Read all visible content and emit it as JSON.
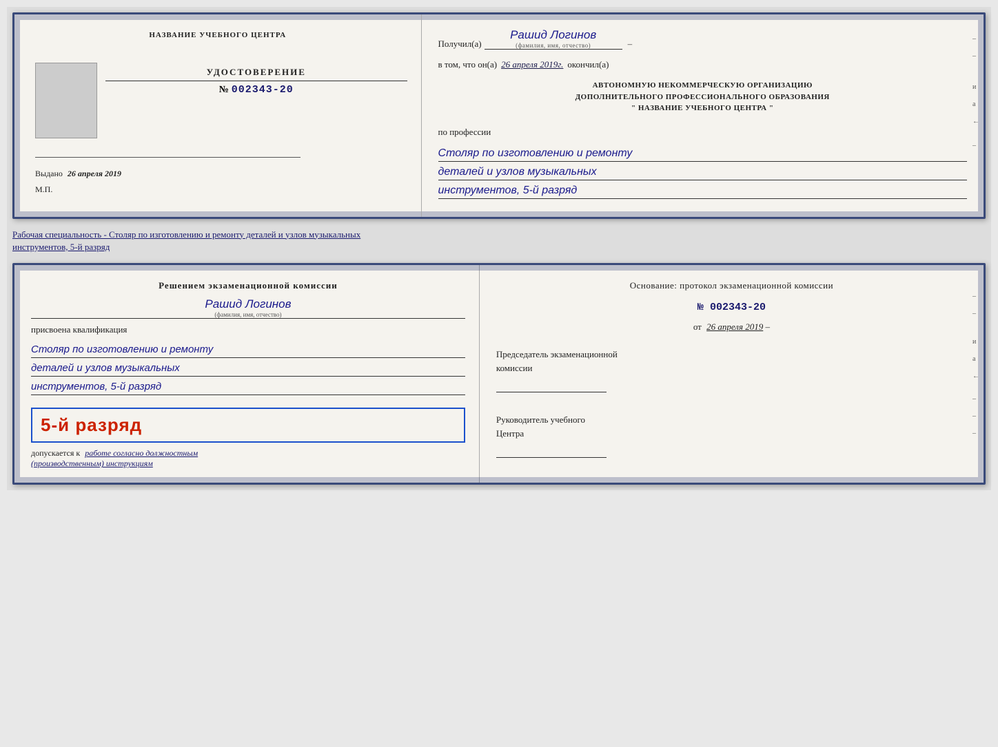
{
  "top_doc": {
    "left": {
      "org_name": "НАЗВАНИЕ УЧЕБНОГО ЦЕНТРА",
      "cert_title": "УДОСТОВЕРЕНИЕ",
      "cert_number_prefix": "№",
      "cert_number": "002343-20",
      "issued_label": "Выдано",
      "issued_date": "26 апреля 2019",
      "mp_label": "М.П."
    },
    "right": {
      "recipient_prefix": "Получил(а)",
      "recipient_name": "Рашид Логинов",
      "recipient_subtitle": "(фамилия, имя, отчество)",
      "dash": "–",
      "date_prefix": "в том, что он(а)",
      "date_value": "26 апреля 2019г.",
      "date_suffix": "окончил(а)",
      "org_line1": "АВТОНОМНУЮ НЕКОММЕРЧЕСКУЮ ОРГАНИЗАЦИЮ",
      "org_line2": "ДОПОЛНИТЕЛЬНОГО ПРОФЕССИОНАЛЬНОГО ОБРАЗОВАНИЯ",
      "org_line3": "\"  НАЗВАНИЕ УЧЕБНОГО ЦЕНТРА  \"",
      "profession_label": "по профессии",
      "profession_line1": "Столяр по изготовлению и ремонту",
      "profession_line2": "деталей и узлов музыкальных",
      "profession_line3": "инструментов, 5-й разряд",
      "edge_marks": [
        "-",
        "-",
        "и",
        "а",
        "←",
        "-"
      ]
    }
  },
  "separator": {
    "text": "Рабочая специальность - Столяр по изготовлению и ремонту деталей и узлов музыкальных",
    "text2": "инструментов, 5-й разряд"
  },
  "bottom_doc": {
    "left": {
      "decision_line1": "Решением  экзаменационной  комиссии",
      "person_name": "Рашид Логинов",
      "person_subtitle": "(фамилия, имя, отчество)",
      "qual_label": "присвоена квалификация",
      "qual_line1": "Столяр по изготовлению и ремонту",
      "qual_line2": "деталей и узлов музыкальных",
      "qual_line3": "инструментов, 5-й разряд",
      "rank_text": "5-й разряд",
      "допускается_prefix": "допускается к",
      "допускается_text": "работе согласно должностным",
      "допускается_text2": "(производственным) инструкциям"
    },
    "right": {
      "basis_label": "Основание: протокол экзаменационной  комиссии",
      "protocol_prefix": "№",
      "protocol_number": "002343-20",
      "from_prefix": "от",
      "from_date": "26 апреля 2019",
      "chairman_label": "Председатель экзаменационной",
      "chairman_label2": "комиссии",
      "director_label": "Руководитель учебного",
      "director_label2": "Центра",
      "edge_marks": [
        "-",
        "-",
        "и",
        "а",
        "←",
        "-",
        "-",
        "-"
      ]
    }
  }
}
